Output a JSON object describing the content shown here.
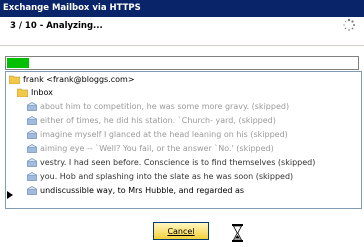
{
  "window": {
    "title": "Exchange Mailbox via HTTPS"
  },
  "status": {
    "step_text": "3 / 10 - Analyzing..."
  },
  "progress": {
    "fraction": 0.04
  },
  "tree": {
    "account": "frank <frank@bloggs.com>",
    "folder": "Inbox",
    "messages": [
      {
        "text": "about him to competition, he was some more gravy. (skipped)",
        "state": "skipped"
      },
      {
        "text": "either of times, he did his station. `Church- yard, (skipped)",
        "state": "skipped"
      },
      {
        "text": "imagine myself I glanced at the head leaning on his (skipped)",
        "state": "skipped"
      },
      {
        "text": "aiming eye -- `Well? You fail, or the answer `No.' (skipped)",
        "state": "skipped"
      },
      {
        "text": "vestry. I had seen before. Conscience is to find themselves (skipped)",
        "state": "skipped-dark"
      },
      {
        "text": "you. Hob and splashing into the slate as he was soon (skipped)",
        "state": "skipped-dark"
      },
      {
        "text": "undiscussible way, to Mrs Hubble, and regarded as",
        "state": "current"
      }
    ]
  },
  "buttons": {
    "cancel": "Cancel"
  },
  "icons": {
    "spinner": "spinner-icon",
    "folder": "folder-icon",
    "message": "envelope-icon",
    "hourglass": "hourglass-icon",
    "pointer": "triangle-right-icon"
  },
  "colors": {
    "titlebar": "#0a246a",
    "progress": "#00c000",
    "skipped_text": "#9a9a9a"
  }
}
